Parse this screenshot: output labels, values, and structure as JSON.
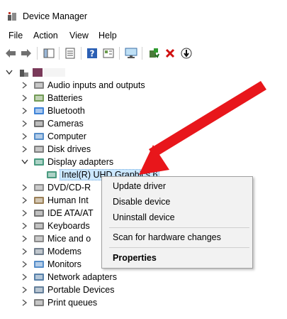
{
  "window": {
    "title": "Device Manager"
  },
  "menu": [
    "File",
    "Action",
    "View",
    "Help"
  ],
  "toolbar": {
    "icons": [
      "back-icon",
      "forward-icon",
      "show-hide-tree-icon",
      "properties-icon",
      "help-icon",
      "action-pane-icon",
      "monitor-icon",
      "update-driver-icon",
      "uninstall-icon",
      "disable-icon"
    ]
  },
  "tree": {
    "categories": [
      {
        "label": "Audio inputs and outputs",
        "icon": "speaker-icon"
      },
      {
        "label": "Batteries",
        "icon": "battery-icon"
      },
      {
        "label": "Bluetooth",
        "icon": "bluetooth-icon"
      },
      {
        "label": "Cameras",
        "icon": "camera-icon"
      },
      {
        "label": "Computer",
        "icon": "computer-icon"
      },
      {
        "label": "Disk drives",
        "icon": "disk-drive-icon"
      },
      {
        "label": "Display adapters",
        "icon": "display-adapter-icon"
      },
      {
        "label": "DVD/CD-R",
        "icon": "dvd-icon"
      },
      {
        "label": "Human Int",
        "icon": "hid-icon"
      },
      {
        "label": "IDE ATA/AT",
        "icon": "ide-icon"
      },
      {
        "label": "Keyboards",
        "icon": "keyboard-icon"
      },
      {
        "label": "Mice and o",
        "icon": "mouse-icon"
      },
      {
        "label": "Modems",
        "icon": "modem-icon"
      },
      {
        "label": "Monitors",
        "icon": "monitor-icon"
      },
      {
        "label": "Network adapters",
        "icon": "network-adapter-icon"
      },
      {
        "label": "Portable Devices",
        "icon": "portable-device-icon"
      },
      {
        "label": "Print queues",
        "icon": "printer-icon"
      }
    ],
    "selected_child": {
      "label": "Intel(R) UHD Graphics 6",
      "icon": "display-adapter-icon"
    }
  },
  "context_menu": {
    "items": [
      "Update driver",
      "Disable device",
      "Uninstall device",
      "Scan for hardware changes",
      "Properties"
    ]
  },
  "colors": {
    "selection": "#cce8ff",
    "arrow": "#e8161b",
    "menu_bg": "#f2f2f2"
  }
}
